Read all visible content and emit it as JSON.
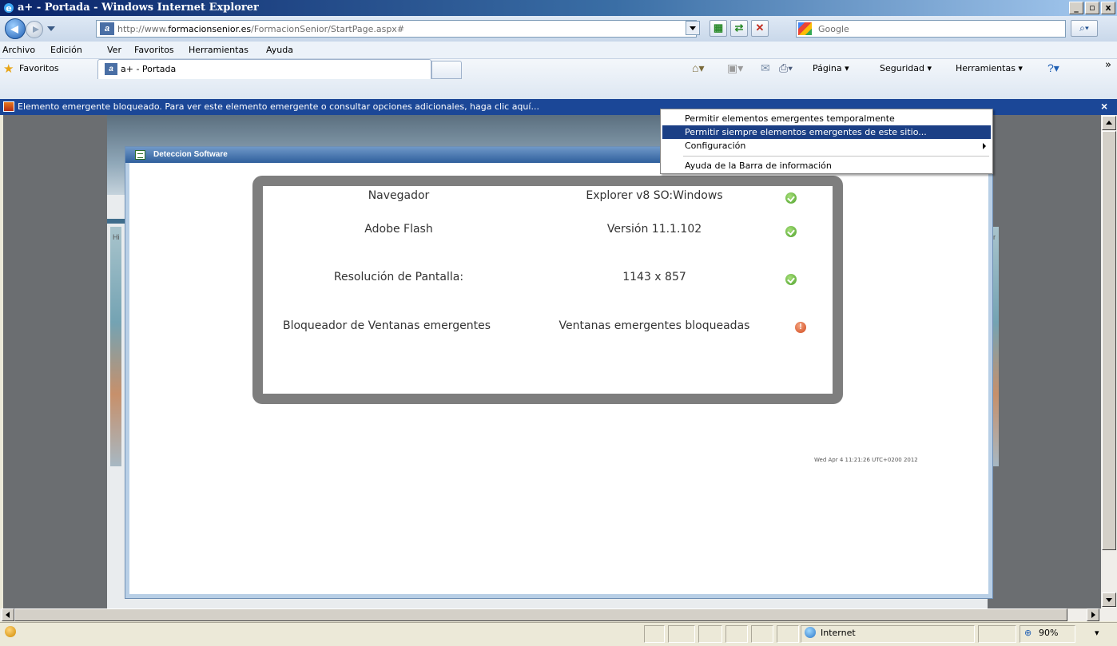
{
  "window": {
    "title": "a+ - Portada - Windows Internet Explorer",
    "minimize": "_",
    "maximize": "▫",
    "close": "x"
  },
  "address": {
    "url_prefix": "http://www.",
    "url_domain": "formacionsenior.es",
    "url_path": "/FormacionSenior/StartPage.aspx#",
    "search_placeholder": "Google",
    "refresh_icon": "refresh-icon",
    "stop_icon": "stop-icon"
  },
  "menu": {
    "items": [
      "Archivo",
      "Edición",
      "Ver",
      "Favoritos",
      "Herramientas",
      "Ayuda"
    ]
  },
  "favorites": {
    "label": "Favoritos",
    "tab_label": "a+ - Portada"
  },
  "command_bar": {
    "page": "Página",
    "security": "Seguridad",
    "tools": "Herramientas",
    "overflow": "»"
  },
  "infobar": {
    "text": "Elemento emergente bloqueado. Para ver este elemento emergente o consultar opciones adicionales, haga clic aquí...",
    "close": "×"
  },
  "context_menu": {
    "items": [
      "Permitir elementos emergentes temporalmente",
      "Permitir siempre elementos emergentes de este sitio...",
      "Configuración",
      "Ayuda de la Barra de información"
    ]
  },
  "background": {
    "stub_left": "Hi",
    "stub_right": "ir"
  },
  "dialog": {
    "title": "Deteccion Software",
    "rows": [
      {
        "label": "Navegador",
        "value": "Explorer v8 SO:Windows",
        "status": "ok"
      },
      {
        "label": "Adobe Flash",
        "value": "Versión 11.1.102",
        "status": "ok"
      },
      {
        "label": "Resolución de Pantalla:",
        "value": "1143 x 857",
        "status": "ok"
      },
      {
        "label": "Bloqueador de Ventanas emergentes",
        "value": "Ventanas emergentes bloqueadas",
        "status": "warning"
      }
    ],
    "warning_glyph": "!",
    "timestamp": "Wed Apr 4 11:21:26 UTC+0200 2012"
  },
  "status": {
    "zone": "Internet",
    "zoom": "90%"
  },
  "colors": {
    "infobar": "#1b4797",
    "menu_selected": "#1b3f85",
    "ok": "#4c9f2a",
    "warning": "#d24a1e"
  }
}
